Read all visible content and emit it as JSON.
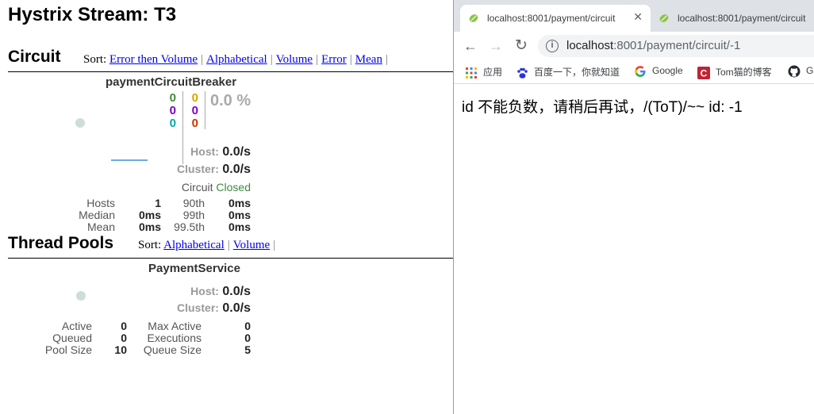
{
  "dashboard": {
    "title": "Hystrix Stream: T3",
    "circuit_section": {
      "title": "Circuit",
      "sort_label": "Sort:",
      "sort_links": [
        "Error then Volume",
        "Alphabetical",
        "Volume",
        "Error",
        "Mean"
      ],
      "card": {
        "name": "paymentCircuitBreaker",
        "counters_left": [
          "0",
          "0",
          "0"
        ],
        "counters_right": [
          "0",
          "0",
          "0"
        ],
        "error_rate": "0.0 %",
        "host_label": "Host:",
        "host_value": "0.0/s",
        "cluster_label": "Cluster:",
        "cluster_value": "0.0/s",
        "circuit_label": "Circuit",
        "circuit_state": "Closed",
        "stats": {
          "hosts_label": "Hosts",
          "hosts": "1",
          "median_label": "Median",
          "median": "0ms",
          "mean_label": "Mean",
          "mean": "0ms",
          "p90_label": "90th",
          "p90": "0ms",
          "p99_label": "99th",
          "p99": "0ms",
          "p995_label": "99.5th",
          "p995": "0ms"
        }
      }
    },
    "thread_pools_section": {
      "title": "Thread Pools",
      "sort_label": "Sort:",
      "sort_links": [
        "Alphabetical",
        "Volume"
      ],
      "card": {
        "name": "PaymentService",
        "host_label": "Host:",
        "host_value": "0.0/s",
        "cluster_label": "Cluster:",
        "cluster_value": "0.0/s",
        "stats": {
          "active_label": "Active",
          "active": "0",
          "queued_label": "Queued",
          "queued": "0",
          "pool_size_label": "Pool Size",
          "pool_size": "10",
          "max_active_label": "Max Active",
          "max_active": "0",
          "executions_label": "Executions",
          "executions": "0",
          "queue_size_label": "Queue Size",
          "queue_size": "5"
        }
      }
    },
    "colors": {
      "success": "#3c8a3c",
      "short_circuited": "#0000ee",
      "bad_request": "#00aaaa",
      "timeout": "#d7a500",
      "rejected": "#7a00c8",
      "failure": "#cc3300",
      "link": "#0000ee"
    }
  },
  "browser": {
    "tabs": [
      {
        "label": "localhost:8001/payment/circuit",
        "favicon": "spring-leaf-icon"
      },
      {
        "label": "localhost:8001/payment/circuit",
        "favicon": "spring-leaf-icon"
      }
    ],
    "url_host": "localhost",
    "url_rest": ":8001/payment/circuit/-1",
    "bookmarks": [
      {
        "label": "应用",
        "icon": "apps-grid-icon"
      },
      {
        "label": "百度一下，你就知道",
        "icon": "baidu-paw-icon"
      },
      {
        "label": "Google",
        "icon": "google-g-icon"
      },
      {
        "label": "Tom猫的博客",
        "icon": "csdn-icon"
      },
      {
        "label": "G",
        "icon": "github-icon"
      }
    ],
    "page_text": "id 不能负数，请稍后再试，/(ToT)/~~ id: -1"
  }
}
